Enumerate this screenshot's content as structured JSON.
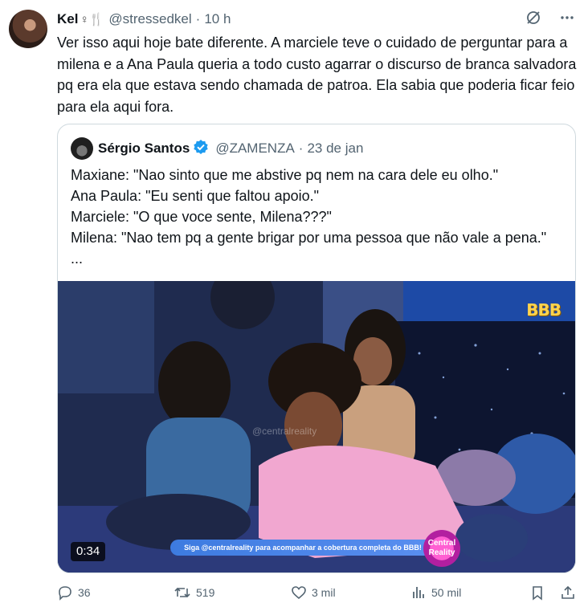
{
  "author": {
    "name": "Kel",
    "name_emoji": "♀🍴",
    "handle": "@stressedkel",
    "time": "10 h"
  },
  "tweet_text": "Ver isso aqui hoje bate diferente. A marciele teve o cuidado de perguntar para a milena e a Ana Paula queria a todo custo agarrar o discurso de branca salvadora pq era ela que estava sendo chamada de patroa. Ela sabia que poderia ficar feio para ela aqui fora.",
  "quote": {
    "name": "Sérgio Santos",
    "handle": "@ZAMENZA",
    "time": "23 de jan",
    "lines": [
      "Maxiane: \"Nao sinto que me abstive pq nem na cara dele eu olho.\"",
      "Ana Paula: \"Eu senti que faltou apoio.\"",
      "Marciele: \"O que voce sente, Milena???\"",
      "Milena: \"Nao tem pq a gente brigar por uma pessoa que não vale a pena.\" ..."
    ],
    "video": {
      "duration": "0:34",
      "logo": "BBB",
      "watermark": "@centralreality",
      "banner": "Siga @centralreality para acompanhar a cobertura completa do BBB!",
      "badge": "Central Reality"
    }
  },
  "actions": {
    "replies": "36",
    "retweets": "519",
    "likes": "3 mil",
    "views": "50 mil"
  },
  "icons": [
    "grok-icon",
    "more-icon",
    "reply-icon",
    "retweet-icon",
    "like-icon",
    "views-icon",
    "bookmark-icon",
    "share-icon",
    "verified-icon"
  ],
  "colors": {
    "text": "#0f1419",
    "muted": "#536471",
    "border": "#cfd9de",
    "verified": "#1d9bf0"
  }
}
